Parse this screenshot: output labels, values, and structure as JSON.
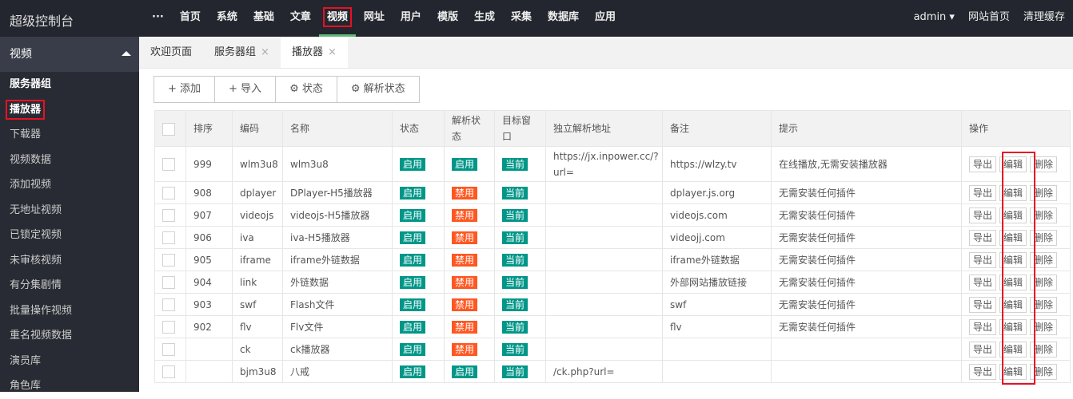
{
  "app_title": "超级控制台",
  "nav": {
    "more": "···",
    "items": [
      "首页",
      "系统",
      "基础",
      "文章",
      "视频",
      "网址",
      "用户",
      "模版",
      "生成",
      "采集",
      "数据库",
      "应用"
    ],
    "active": "视频"
  },
  "header_right": {
    "user": "admin",
    "home": "网站首页",
    "clear_cache": "清理缓存"
  },
  "sidebar": {
    "section": "视频",
    "items": [
      "服务器组",
      "播放器",
      "下载器",
      "视频数据",
      "添加视频",
      "无地址视频",
      "已锁定视频",
      "未审核视频",
      "有分集剧情",
      "批量操作视频",
      "重名视频数据",
      "演员库",
      "角色库"
    ],
    "active": "播放器"
  },
  "tabs": [
    {
      "label": "欢迎页面",
      "closable": false
    },
    {
      "label": "服务器组",
      "closable": true
    },
    {
      "label": "播放器",
      "closable": true,
      "active": true
    }
  ],
  "tab_close": "×",
  "toolbar": {
    "add": "+ 添加",
    "import": "+ 导入",
    "status": "⚙ 状态",
    "parse_status": "⚙ 解析状态"
  },
  "table": {
    "headers": [
      "排序",
      "编码",
      "名称",
      "状态",
      "解析状态",
      "目标窗口",
      "独立解析地址",
      "备注",
      "提示",
      "操作"
    ],
    "actions": [
      "导出",
      "编辑",
      "删除"
    ],
    "rows": [
      [
        "999",
        "wlm3u8",
        "wlm3u8",
        "启用",
        "启用",
        "当前",
        "https://jx.inpower.cc/?url=",
        "https://wlzy.tv",
        "在线播放,无需安装播放器"
      ],
      [
        "908",
        "dplayer",
        "DPlayer-H5播放器",
        "启用",
        "禁用",
        "当前",
        "",
        "dplayer.js.org",
        "无需安装任何插件"
      ],
      [
        "907",
        "videojs",
        "videojs-H5播放器",
        "启用",
        "禁用",
        "当前",
        "",
        "videojs.com",
        "无需安装任何插件"
      ],
      [
        "906",
        "iva",
        "iva-H5播放器",
        "启用",
        "禁用",
        "当前",
        "",
        "videojj.com",
        "无需安装任何插件"
      ],
      [
        "905",
        "iframe",
        "iframe外链数据",
        "启用",
        "禁用",
        "当前",
        "",
        "iframe外链数据",
        "无需安装任何插件"
      ],
      [
        "904",
        "link",
        "外链数据",
        "启用",
        "禁用",
        "当前",
        "",
        "外部网站播放链接",
        "无需安装任何插件"
      ],
      [
        "903",
        "swf",
        "Flash文件",
        "启用",
        "禁用",
        "当前",
        "",
        "swf",
        "无需安装任何插件"
      ],
      [
        "902",
        "flv",
        "Flv文件",
        "启用",
        "禁用",
        "当前",
        "",
        "flv",
        "无需安装任何插件"
      ],
      [
        "",
        "ck",
        "ck播放器",
        "启用",
        "禁用",
        "当前",
        "",
        "",
        ""
      ],
      [
        "",
        "bjm3u8",
        "八戒",
        "启用",
        "启用",
        "当前",
        "/ck.php?url=",
        "",
        ""
      ]
    ]
  },
  "colors": {
    "enabled": "#009688",
    "disabled": "#ff5722",
    "topbar": "#23262e",
    "sidebar": "#282b33",
    "highlight": "#e81123"
  }
}
